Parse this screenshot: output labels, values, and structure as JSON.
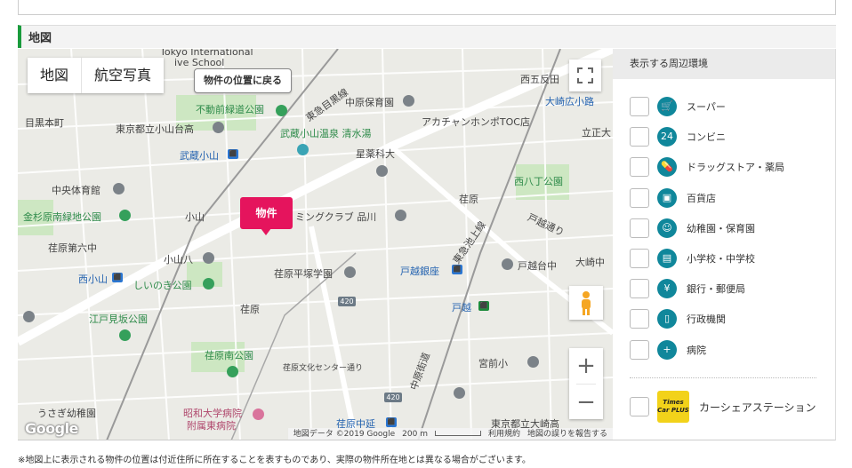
{
  "section": {
    "title": "地図"
  },
  "map": {
    "map_type_buttons": [
      "地図",
      "航空写真"
    ],
    "back_button_label": "物件の位置に戻る",
    "marker_label": "物件",
    "google_logo": "Google",
    "attribution": {
      "map_data": "地図データ ©2019 Google",
      "scale": "200 m",
      "terms": "利用規約",
      "report": "地図の誤りを報告する"
    },
    "zoom_in": "+",
    "zoom_out": "−",
    "labels": {
      "tokyo_intl": "Tokyo International",
      "live_school": "ive School",
      "nishi_gotanda": "西五反田",
      "osaki_hirokoji": "大崎広小路",
      "meguro_line": "東急目黒線",
      "nakahara_nursery": "中原保育園",
      "fudomae": "不動前緑道公園",
      "meguro_moto": "目黒本町",
      "koyama_dai": "東京都立小山台高",
      "akachan_honpo": "アカチャンホンポTOC店",
      "tatsumi": "立正大",
      "musashi_onsen": "武蔵小山温泉 清水湯",
      "hoshi_yakka": "星薬科大",
      "musashi_koyama": "武蔵小山",
      "nishi_hachome": "西八丁公園",
      "chuo_gym": "中央体育館",
      "haramachi": "荏原",
      "koyama": "小山",
      "swimming": "ミングクラブ 品川",
      "kinshi_park": "金杉原南緑地公園",
      "togoshi_dori": "戸越通り",
      "ikegami_line": "東急池上線",
      "hara_6": "荏原第六中",
      "koyama_hachi": "小山八",
      "togoshi_ginza": "戸越銀座",
      "togoshi_dai": "戸越台中",
      "osaki_chu": "大崎中",
      "nishi_koyama": "西小山",
      "shiinoki": "しいのき公園",
      "hara_heian": "荏原平塚学園",
      "edomi": "江戸見坂公園",
      "haramachi2": "荏原",
      "togoshi": "戸越",
      "hara_minami": "荏原南公園",
      "bunka_center": "荏原文化センター通り",
      "miyamae": "宮前小",
      "usagi": "うさぎ幼稚園",
      "showa": "昭和大学病院",
      "showa2": "附属東病院",
      "nakanobu": "荏原中延",
      "osaki_high": "東京都立大崎高",
      "route420a": "420",
      "route420b": "420",
      "nakahara_rd": "中原街道"
    }
  },
  "panel": {
    "header": "表示する周辺環境",
    "items": [
      {
        "label": "スーパー",
        "icon": "cart-icon"
      },
      {
        "label": "コンビニ",
        "icon": "convenience-store-icon"
      },
      {
        "label": "ドラッグストア・薬局",
        "icon": "pill-icon"
      },
      {
        "label": "百貨店",
        "icon": "shopping-bag-icon"
      },
      {
        "label": "幼稚園・保育園",
        "icon": "child-icon"
      },
      {
        "label": "小学校・中学校",
        "icon": "school-bag-icon"
      },
      {
        "label": "銀行・郵便局",
        "icon": "yen-icon"
      },
      {
        "label": "行政機関",
        "icon": "document-icon"
      },
      {
        "label": "病院",
        "icon": "hospital-icon"
      }
    ],
    "car_share": {
      "label": "カーシェアステーション",
      "logo_text": "Times Car PLUS"
    }
  },
  "footnote": "※地図上に表示される物件の位置は付近住所に所在することを表すものであり、実際の物件所在地とは異なる場合がございます。"
}
